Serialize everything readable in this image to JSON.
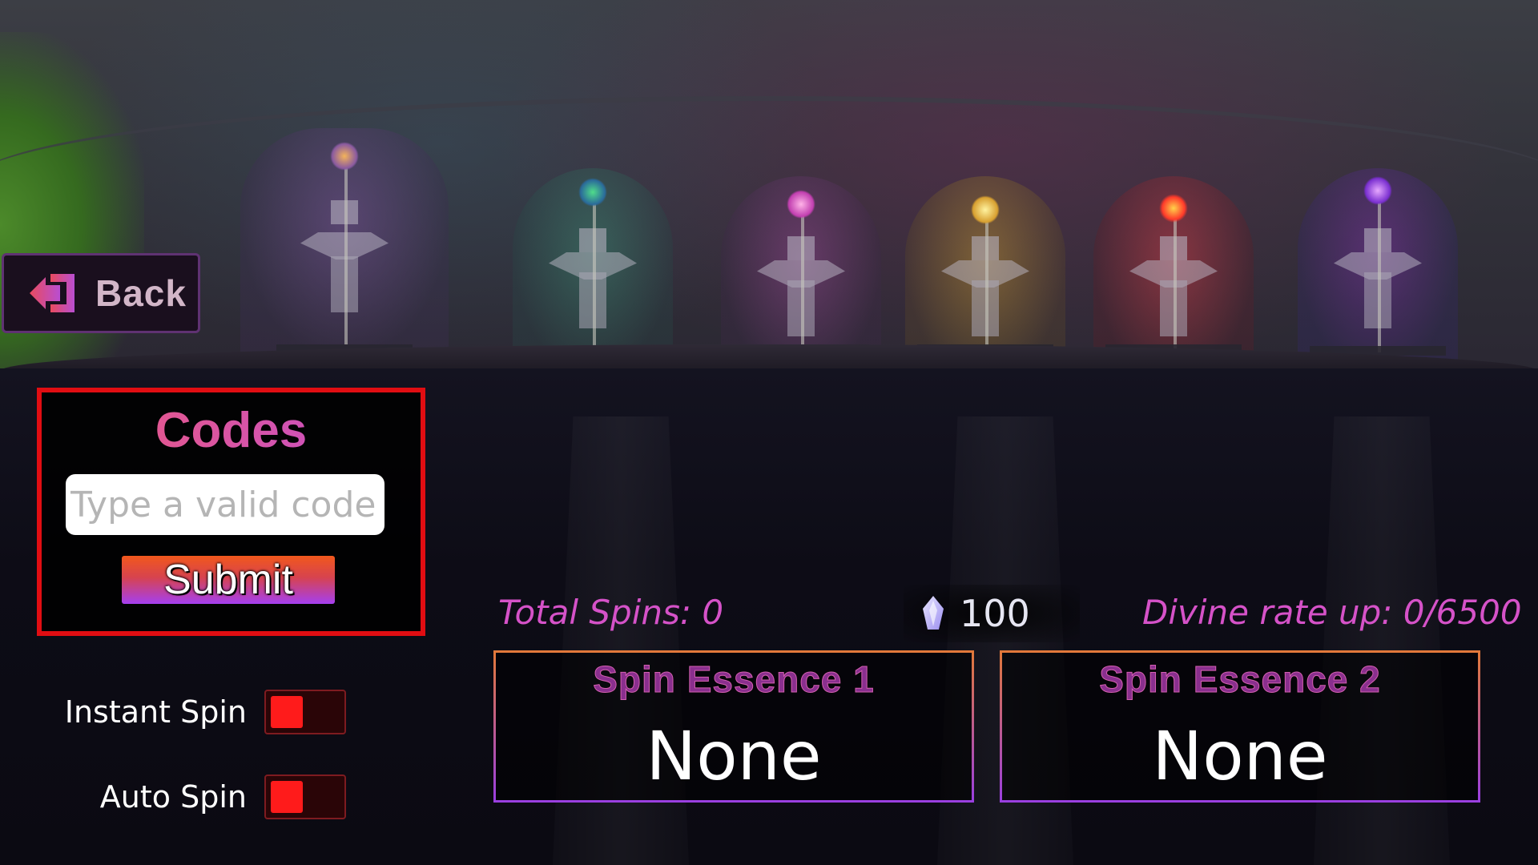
{
  "back_button": {
    "label": "Back",
    "icon": "exit-arrow-icon"
  },
  "codes": {
    "title": "Codes",
    "input_placeholder": "Type a valid code",
    "input_value": "",
    "submit_label": "Submit"
  },
  "toggles": {
    "instant_spin": {
      "label": "Instant Spin",
      "on": false
    },
    "auto_spin": {
      "label": "Auto Spin",
      "on": false
    }
  },
  "stats": {
    "total_spins": "Total Spins: 0",
    "currency_value": "100",
    "currency_icon": "crystal-gem-icon",
    "divine_rate": "Divine rate up: 0/6500"
  },
  "essences": [
    {
      "title": "Spin Essence 1",
      "value": "None"
    },
    {
      "title": "Spin Essence 2",
      "value": "None"
    }
  ],
  "colors": {
    "codes_border": "#e10d12",
    "stat_text": "#d552c8",
    "toggle_off": "#ff1b1b",
    "essence_border": "#8a3fd0"
  }
}
